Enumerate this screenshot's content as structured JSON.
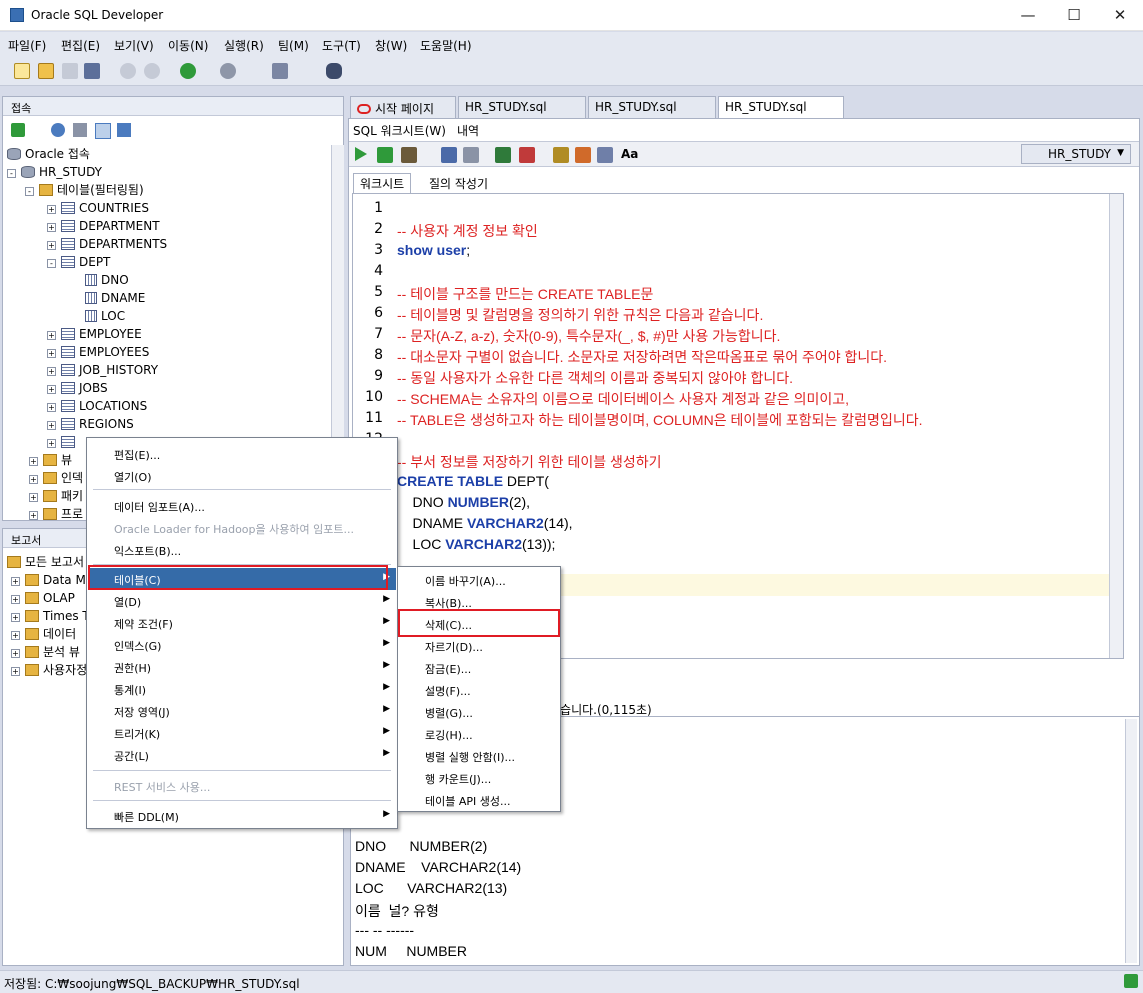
{
  "window": {
    "title": "Oracle SQL Developer"
  },
  "menubar": [
    "파일(F)",
    "편집(E)",
    "보기(V)",
    "이동(N)",
    "실행(R)",
    "팀(M)",
    "도구(T)",
    "창(W)",
    "도움말(H)"
  ],
  "connections_panel": {
    "title": "접속"
  },
  "tree": {
    "root": "Oracle 접속",
    "conn": "HR_STUDY",
    "tables_folder": "테이블(필터링됨)",
    "tables_before": [
      "COUNTRIES",
      "DEPARTMENT",
      "DEPARTMENTS"
    ],
    "dept": "DEPT",
    "dept_cols": [
      "DNO",
      "DNAME",
      "LOC"
    ],
    "tables_after": [
      "EMPLOYEE",
      "EMPLOYEES",
      "JOB_HISTORY",
      "JOBS",
      "LOCATIONS",
      "REGIONS"
    ],
    "folders": [
      "뷰",
      "인덱",
      "패키",
      "프로"
    ]
  },
  "reports_panel": {
    "title": "보고서",
    "root": "모든 보고서",
    "items": [
      "Data M",
      "OLAP",
      "Times T",
      "데이터",
      "분석 뷰",
      "사용자정"
    ]
  },
  "tabs": [
    "시작 페이지",
    "HR_STUDY.sql",
    "HR_STUDY.sql",
    "HR_STUDY.sql"
  ],
  "worksheet": {
    "tab1": "SQL 워크시트(W)",
    "tab2": "내역",
    "sub1": "워크시트",
    "sub2": "질의 작성기",
    "connection": "HR_STUDY"
  },
  "code": [
    {
      "n": "1",
      "parts": []
    },
    {
      "n": "2",
      "parts": [
        {
          "c": "cm",
          "t": "-- 사용자 계정 정보 확인"
        }
      ]
    },
    {
      "n": "3",
      "parts": [
        {
          "c": "kw",
          "t": "show user"
        },
        {
          "c": "",
          "t": ";"
        }
      ]
    },
    {
      "n": "4",
      "parts": []
    },
    {
      "n": "5",
      "parts": [
        {
          "c": "cm",
          "t": "-- 테이블 구조를 만드는 CREATE TABLE문"
        }
      ]
    },
    {
      "n": "6",
      "parts": [
        {
          "c": "cm",
          "t": "-- 테이블명 및 칼럼명을 정의하기 위한 규칙은 다음과 같습니다."
        }
      ]
    },
    {
      "n": "7",
      "parts": [
        {
          "c": "cm",
          "t": "-- 문자(A-Z, a-z), 숫자(0-9), 특수문자(_, $, #)만 사용 가능합니다."
        }
      ]
    },
    {
      "n": "8",
      "parts": [
        {
          "c": "cm",
          "t": "-- 대소문자 구별이 없습니다. 소문자로 저장하려면 작은따옴표로 묶어 주어야 합니다."
        }
      ]
    },
    {
      "n": "9",
      "parts": [
        {
          "c": "cm",
          "t": "-- 동일 사용자가 소유한 다른 객체의 이름과 중복되지 않아야 합니다."
        }
      ]
    },
    {
      "n": "10",
      "parts": [
        {
          "c": "cm",
          "t": "-- SCHEMA는 소유자의 이름으로 데이터베이스 사용자 계정과 같은 의미이고,"
        }
      ]
    },
    {
      "n": "11",
      "parts": [
        {
          "c": "cm",
          "t": "-- TABLE은 생성하고자 하는 테이블명이며, COLUMN은 테이블에 포함되는 칼럼명입니다."
        }
      ]
    },
    {
      "n": "12",
      "parts": []
    },
    {
      "n": "",
      "parts": [
        {
          "c": "cm",
          "t": "-- 부서 정보를 저장하기 위한 테이블 생성하기"
        }
      ]
    },
    {
      "n": "",
      "parts": [
        {
          "c": "kw",
          "t": "CREATE TABLE"
        },
        {
          "c": "",
          "t": " DEPT("
        }
      ]
    },
    {
      "n": "",
      "parts": [
        {
          "c": "",
          "t": "    DNO "
        },
        {
          "c": "kw",
          "t": "NUMBER"
        },
        {
          "c": "",
          "t": "(2),"
        }
      ]
    },
    {
      "n": "",
      "parts": [
        {
          "c": "",
          "t": "    DNAME "
        },
        {
          "c": "kw",
          "t": "VARCHAR2"
        },
        {
          "c": "",
          "t": "(14),"
        }
      ]
    },
    {
      "n": "",
      "parts": [
        {
          "c": "",
          "t": "    LOC "
        },
        {
          "c": "kw",
          "t": "VARCHAR2"
        },
        {
          "c": "",
          "t": "(13));"
        }
      ]
    }
  ],
  "script_status": "었습니다.(0,115초)",
  "output_lines": [
    "니다.",
    "",
    "",
    "",
    "",
    "DNO      NUMBER(2)",
    "DNAME    VARCHAR2(14)",
    "LOC      VARCHAR2(13)",
    "이름  널? 유형",
    "--- -- ------",
    "NUM     NUMBER"
  ],
  "context_menu": {
    "items": [
      "편집(E)...",
      "열기(O)",
      "데이터 임포트(A)...",
      "Oracle Loader for Hadoop을 사용하여 임포트...",
      "익스포트(B)...",
      "테이블(C)",
      "열(D)",
      "제약 조건(F)",
      "인덱스(G)",
      "권한(H)",
      "통계(I)",
      "저장 영역(J)",
      "트리거(K)",
      "공간(L)",
      "REST 서비스 사용...",
      "빠른 DDL(M)"
    ]
  },
  "submenu": {
    "items": [
      "이름 바꾸기(A)...",
      "복사(B)...",
      "삭제(C)...",
      "자르기(D)...",
      "잠금(E)...",
      "설명(F)...",
      "병렬(G)...",
      "로깅(H)...",
      "병렬 실행 안함(I)...",
      "행 카운트(J)...",
      "테이블 API 생성..."
    ]
  },
  "statusbar": {
    "text": "저장됨: C:₩soojung₩SQL_BACKUP₩HR_STUDY.sql"
  }
}
